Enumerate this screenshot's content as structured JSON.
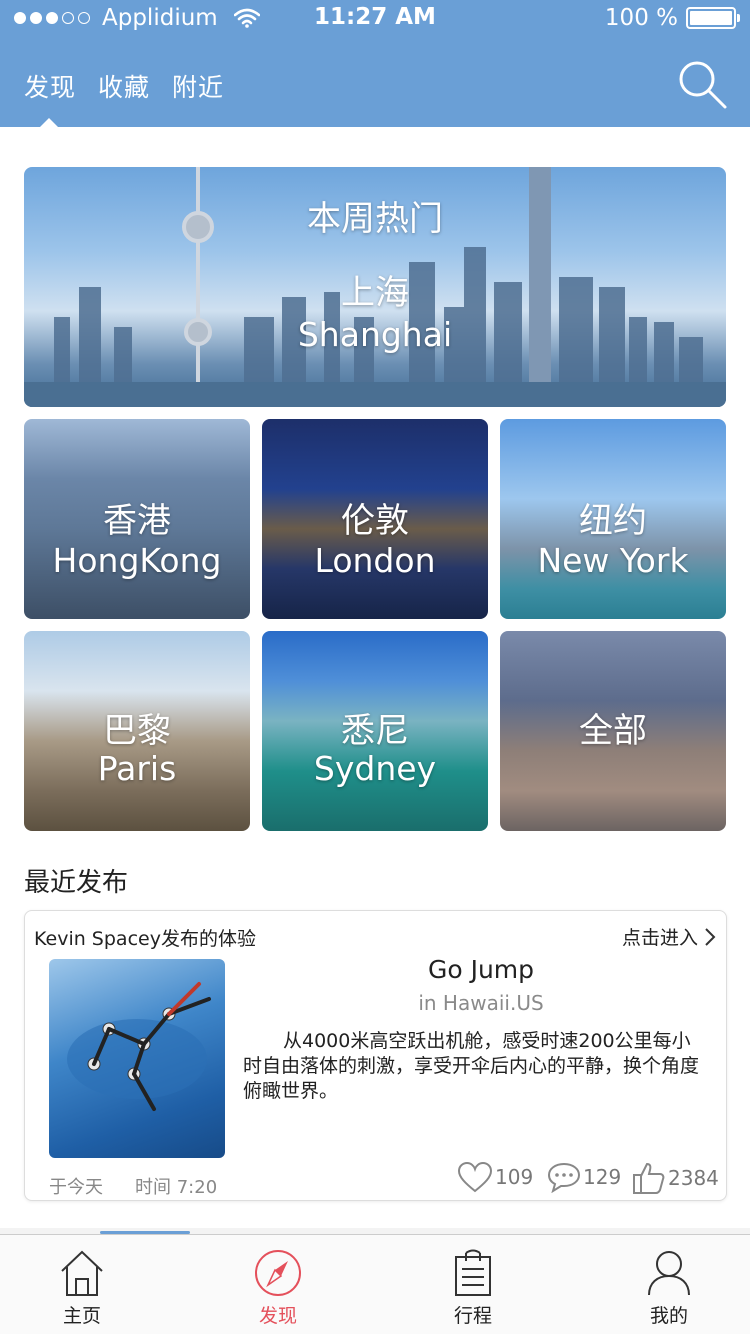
{
  "status_bar": {
    "carrier": "Applidium",
    "time": "11:27 AM",
    "battery": "100 %",
    "signal_bars_filled": 3,
    "signal_bars_total": 5
  },
  "top_tabs": [
    {
      "label": "发现"
    },
    {
      "label": "收藏"
    },
    {
      "label": "附近"
    }
  ],
  "active_top_tab": "发现",
  "hero": {
    "title": "本周热门",
    "city_cn": "上海",
    "city_en": "Shanghai"
  },
  "cities": [
    {
      "cn": "香港",
      "en": "HongKong"
    },
    {
      "cn": "伦敦",
      "en": "London"
    },
    {
      "cn": "纽约",
      "en": "New York"
    },
    {
      "cn": "巴黎",
      "en": "Paris"
    },
    {
      "cn": "悉尼",
      "en": "Sydney"
    },
    {
      "cn": "全部",
      "en": ""
    }
  ],
  "recent": {
    "section_title": "最近发布",
    "card": {
      "author": "Kevin Spacey发布的体验",
      "enter_label": "点击进入",
      "title": "Go Jump",
      "location": "in Hawaii.US",
      "description": "从4000米高空跃出机舱，感受时速200公里每小时自由落体的刺激，享受开伞后内心的平静，换个角度俯瞰世界。",
      "date": "于今天",
      "time": "时间 7:20",
      "likes": "109",
      "comments": "129",
      "thumbs": "2384"
    }
  },
  "tabbar": [
    {
      "label": "主页",
      "icon": "home-icon"
    },
    {
      "label": "发现",
      "icon": "compass-icon"
    },
    {
      "label": "行程",
      "icon": "itinerary-icon"
    },
    {
      "label": "我的",
      "icon": "user-icon"
    }
  ],
  "colors": {
    "header_bg": "#6a9fd6",
    "active_tab": "#e4505b"
  }
}
